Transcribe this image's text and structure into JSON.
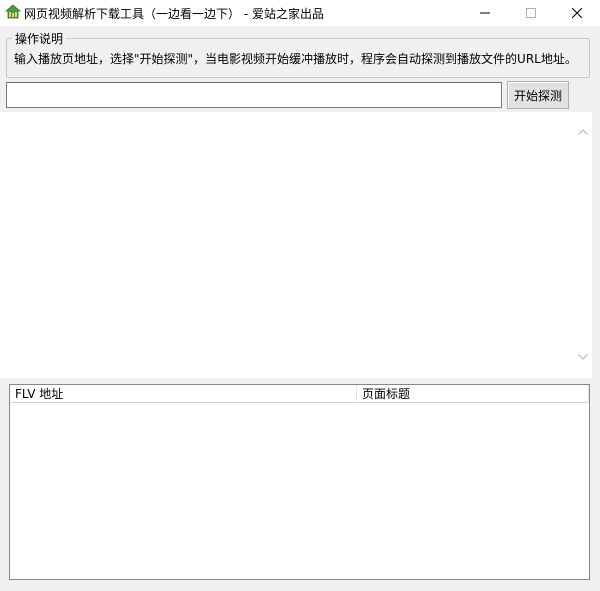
{
  "window": {
    "title": "网页视频解析下载工具（一边看一边下） - 爱站之家出品",
    "icon": "house-icon",
    "controls": [
      "minimize",
      "maximize",
      "close"
    ]
  },
  "instructions": {
    "legend": "操作说明",
    "text": "输入播放页地址，选择\"开始探测\"，当电影视频开始缓冲播放时，程序会自动探测到播放文件的URL地址。"
  },
  "url_input": {
    "value": "",
    "placeholder": ""
  },
  "start_button": {
    "label": "开始探测"
  },
  "list": {
    "columns": [
      "FLV 地址",
      "页面标题"
    ],
    "rows": []
  },
  "colors": {
    "window_bg": "#f0f0f0",
    "titlebar_bg": "#ffffff",
    "content_bg": "#ffffff",
    "icon_green": "#3a8a2e"
  }
}
